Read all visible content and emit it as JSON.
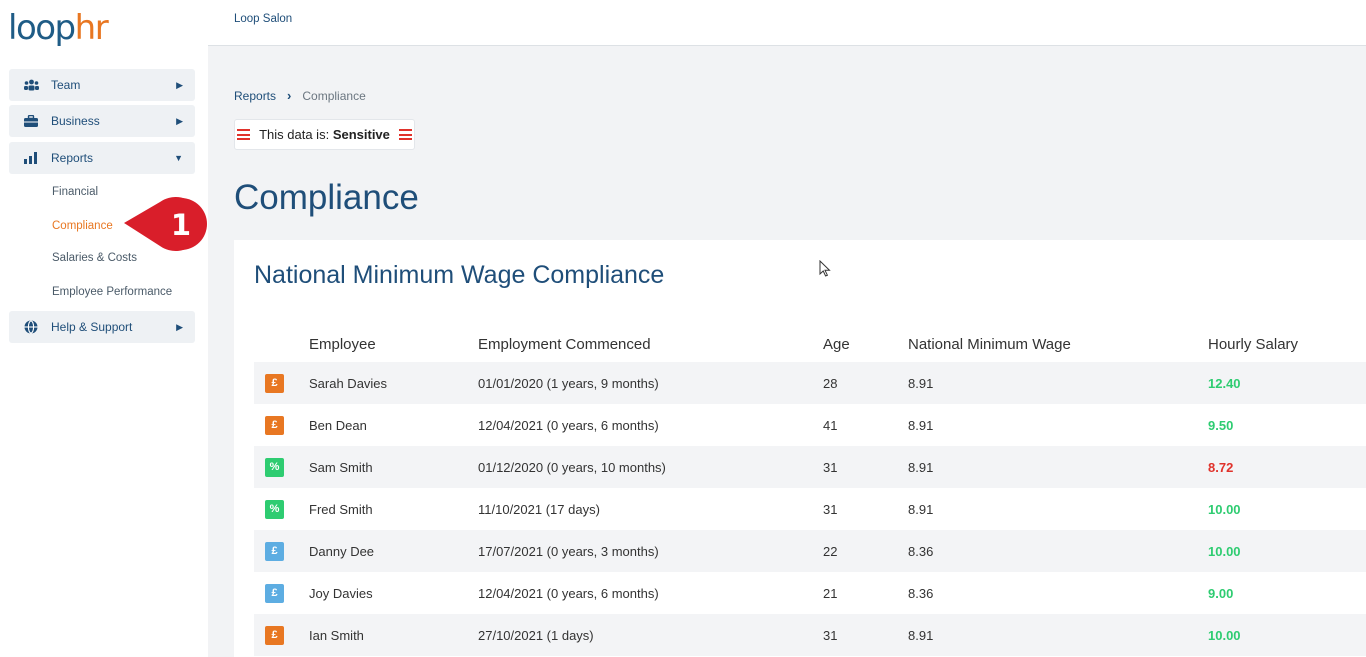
{
  "app": {
    "logo_main": "loop",
    "logo_accent": "hr",
    "company": "Loop Salon"
  },
  "sidebar": {
    "team": "Team",
    "business": "Business",
    "reports": "Reports",
    "reports_sub": [
      "Financial",
      "Compliance",
      "Salaries & Costs",
      "Employee Performance"
    ],
    "help": "Help & Support"
  },
  "callout": {
    "number": "1"
  },
  "breadcrumb": {
    "parent": "Reports",
    "current": "Compliance"
  },
  "sensitivity": {
    "prefix": "This data is:",
    "level": "Sensitive"
  },
  "page": {
    "title": "Compliance"
  },
  "card": {
    "title": "National Minimum Wage Compliance"
  },
  "table": {
    "headers": {
      "employee": "Employee",
      "commenced": "Employment Commenced",
      "age": "Age",
      "nmw": "National Minimum Wage",
      "salary": "Hourly Salary"
    },
    "rows": [
      {
        "icon": "£",
        "icon_color": "#e87722",
        "employee": "Sarah Davies",
        "commenced": "01/01/2020 (1 years, 9 months)",
        "age": "28",
        "nmw": "8.91",
        "salary": "12.40",
        "salary_color": "#2ecc71"
      },
      {
        "icon": "£",
        "icon_color": "#e87722",
        "employee": "Ben Dean",
        "commenced": "12/04/2021 (0 years, 6 months)",
        "age": "41",
        "nmw": "8.91",
        "salary": "9.50",
        "salary_color": "#2ecc71"
      },
      {
        "icon": "%",
        "icon_color": "#2ecc71",
        "employee": "Sam Smith",
        "commenced": "01/12/2020 (0 years, 10 months)",
        "age": "31",
        "nmw": "8.91",
        "salary": "8.72",
        "salary_color": "#e0322b"
      },
      {
        "icon": "%",
        "icon_color": "#2ecc71",
        "employee": "Fred Smith",
        "commenced": "11/10/2021 (17 days)",
        "age": "31",
        "nmw": "8.91",
        "salary": "10.00",
        "salary_color": "#2ecc71"
      },
      {
        "icon": "£",
        "icon_color": "#5dade2",
        "employee": "Danny Dee",
        "commenced": "17/07/2021 (0 years, 3 months)",
        "age": "22",
        "nmw": "8.36",
        "salary": "10.00",
        "salary_color": "#2ecc71"
      },
      {
        "icon": "£",
        "icon_color": "#5dade2",
        "employee": "Joy Davies",
        "commenced": "12/04/2021 (0 years, 6 months)",
        "age": "21",
        "nmw": "8.36",
        "salary": "9.00",
        "salary_color": "#2ecc71"
      },
      {
        "icon": "£",
        "icon_color": "#e87722",
        "employee": "Ian Smith",
        "commenced": "27/10/2021 (1 days)",
        "age": "31",
        "nmw": "8.91",
        "salary": "10.00",
        "salary_color": "#2ecc71"
      }
    ]
  }
}
